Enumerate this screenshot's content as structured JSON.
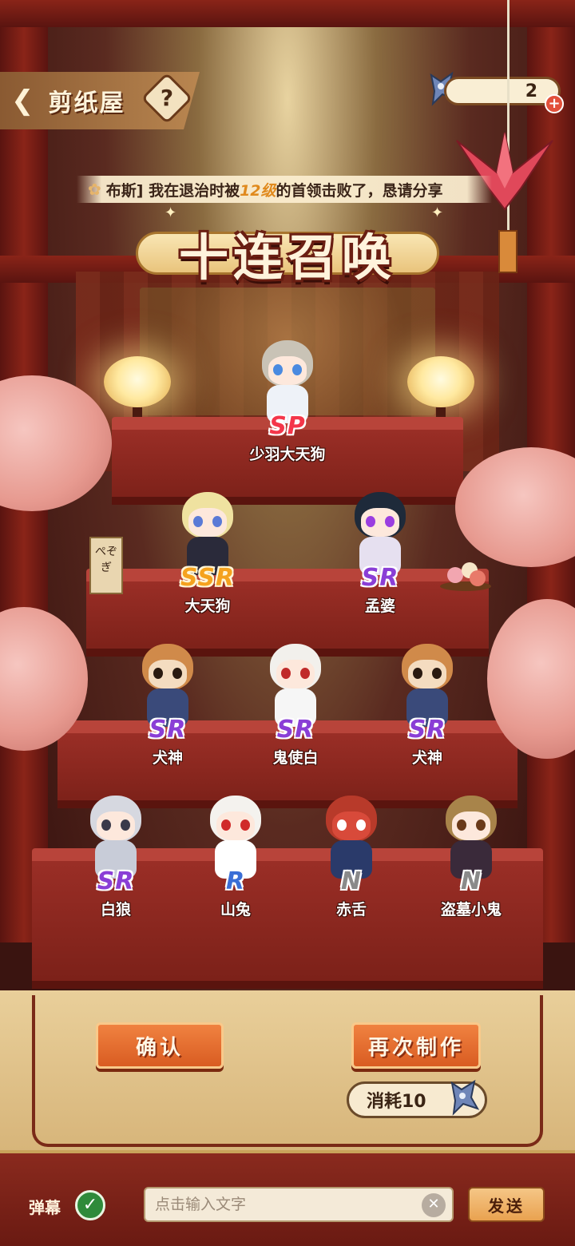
{
  "header": {
    "back_arrow": "❮",
    "title": "剪纸屋",
    "help_label": "?"
  },
  "currency": {
    "count": "2",
    "plus_label": "+"
  },
  "marquee": {
    "prefix": "布斯]  我在退治时被",
    "level": "12级",
    "suffix": "的首领击败了，恳请",
    "action": "分享"
  },
  "title_banner": {
    "text": "十连召唤"
  },
  "characters": [
    {
      "rarity": "SP",
      "name": "少羽大天狗"
    },
    {
      "rarity": "SSR",
      "name": "大天狗"
    },
    {
      "rarity": "SR",
      "name": "孟婆"
    },
    {
      "rarity": "SR",
      "name": "犬神"
    },
    {
      "rarity": "SR",
      "name": "鬼使白"
    },
    {
      "rarity": "SR",
      "name": "犬神"
    },
    {
      "rarity": "SR",
      "name": "白狼"
    },
    {
      "rarity": "R",
      "name": "山兔"
    },
    {
      "rarity": "N",
      "name": "赤舌"
    },
    {
      "rarity": "N",
      "name": "盗墓小鬼"
    }
  ],
  "actions": {
    "confirm_label": "确认",
    "remake_label": "再次制作",
    "cost_label": "消耗10"
  },
  "sign": {
    "text": "ぺぞぎ"
  },
  "bottom_bar": {
    "danmaku_label": "弹幕",
    "danmaku_check": "✓",
    "input_placeholder": "点击输入文字",
    "clear_label": "✕",
    "send_label": "发送"
  },
  "colors": {
    "rarity_sp": "#f4364a",
    "rarity_ssr": "#f5a21e",
    "rarity_sr": "#8a3ed6",
    "rarity_r": "#3a6ed6",
    "rarity_n": "#8a8a8a",
    "button_orange": "#e86a2c"
  }
}
